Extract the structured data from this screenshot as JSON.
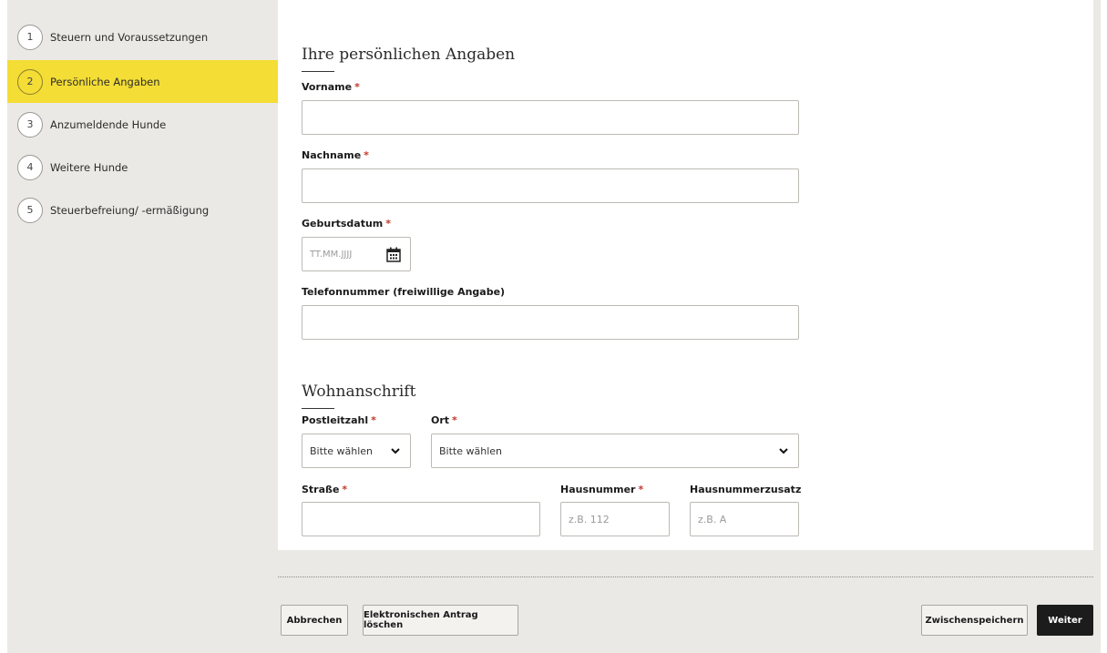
{
  "steps": [
    {
      "number": "1",
      "label": "Steuern und Voraussetzungen",
      "active": false
    },
    {
      "number": "2",
      "label": "Persönliche Angaben",
      "active": true
    },
    {
      "number": "3",
      "label": "Anzumeldende Hunde",
      "active": false
    },
    {
      "number": "4",
      "label": "Weitere Hunde",
      "active": false
    },
    {
      "number": "5",
      "label": "Steuerbefreiung/ -ermäßigung",
      "active": false
    }
  ],
  "personal": {
    "title": "Ihre persönlichen Angaben",
    "vorname_label": "Vorname",
    "nachname_label": "Nachname",
    "geburtsdatum_label": "Geburtsdatum",
    "geburtsdatum_placeholder": "TT.MM.JJJJ",
    "telefon_label": "Telefonnummer (freiwillige Angabe)",
    "required_mark": "*"
  },
  "address": {
    "title": "Wohnanschrift",
    "plz_label": "Postleitzahl",
    "plz_value": "Bitte wählen",
    "ort_label": "Ort",
    "ort_value": "Bitte wählen",
    "strasse_label": "Straße",
    "hausnummer_label": "Hausnummer",
    "hausnummer_placeholder": "z.B. 112",
    "zusatz_label": "Hausnummerzusatz",
    "zusatz_placeholder": "z.B. A"
  },
  "buttons": {
    "cancel": "Abbrechen",
    "delete": "Elektronischen Antrag löschen",
    "save": "Zwischenspeichern",
    "next": "Weiter"
  },
  "colors": {
    "active_step": "#f4dd35",
    "required": "#c0392b",
    "primary_button": "#1c1c1c"
  }
}
